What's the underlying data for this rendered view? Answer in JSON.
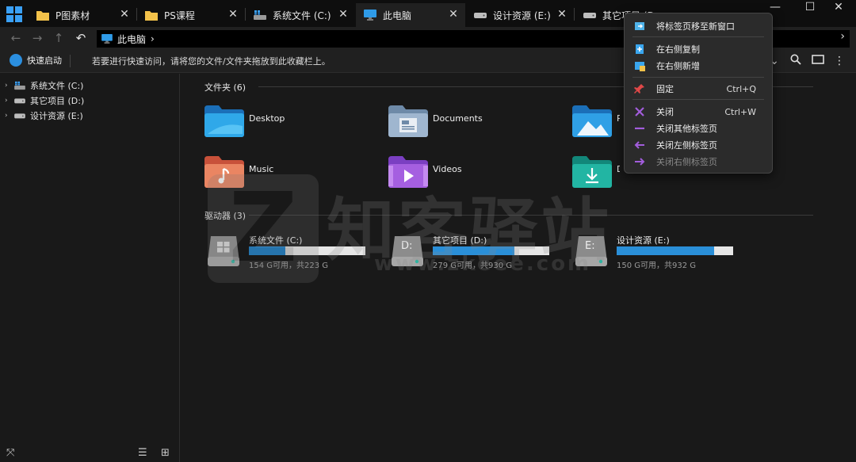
{
  "tabs": [
    {
      "label": "P图素材",
      "icon": "folder-icon"
    },
    {
      "label": "PS课程",
      "icon": "folder-icon"
    },
    {
      "label": "系统文件 (C:)",
      "icon": "windows-drive-icon"
    },
    {
      "label": "此电脑",
      "icon": "monitor-icon",
      "active": true
    },
    {
      "label": "设计资源 (E:)",
      "icon": "drive-icon"
    },
    {
      "label": "其它项目 (D:)",
      "icon": "drive-icon"
    }
  ],
  "window_controls": {
    "minimize": "—",
    "maximize": "☐",
    "close": "✕"
  },
  "nav": {
    "back": "←",
    "forward": "→",
    "up": "↑",
    "refresh": "↶"
  },
  "address": {
    "path": "此电脑",
    "chevron": "›",
    "end_chevron": "›"
  },
  "quick_access": {
    "label": "快速启动",
    "hint": "若要进行快速访问，请将您的文件/文件夹拖放到此收藏栏上。"
  },
  "sidebar": {
    "items": [
      {
        "label": "系统文件 (C:)",
        "icon": "windows-drive-icon"
      },
      {
        "label": "其它项目 (D:)",
        "icon": "drive-icon"
      },
      {
        "label": "设计资源 (E:)",
        "icon": "drive-icon"
      }
    ]
  },
  "folders_section": {
    "title": "文件夹 (6)",
    "items": [
      {
        "name": "Desktop",
        "icon": "desktop-folder-icon"
      },
      {
        "name": "Documents",
        "icon": "documents-folder-icon"
      },
      {
        "name": "Pi",
        "icon": "pictures-folder-icon"
      },
      {
        "name": "Music",
        "icon": "music-folder-icon"
      },
      {
        "name": "Videos",
        "icon": "videos-folder-icon"
      },
      {
        "name": "Do",
        "icon": "downloads-folder-icon"
      }
    ]
  },
  "drives_section": {
    "title": "驱动器 (3)",
    "items": [
      {
        "name": "系统文件 (C:)",
        "letter": "",
        "free": "154 G可用，共223 G",
        "used_fraction": 0.31
      },
      {
        "name": "其它项目 (D:)",
        "letter": "D:",
        "free": "279 G可用，共930 G",
        "used_fraction": 0.7
      },
      {
        "name": "设计资源 (E:)",
        "letter": "E:",
        "free": "150 G可用，共932 G",
        "used_fraction": 0.84
      }
    ]
  },
  "context_menu": {
    "items": [
      {
        "label": "将标签页移至新窗口",
        "shortcut": "",
        "icon": "new-window-icon"
      },
      {
        "label": "在右侧复制",
        "shortcut": "",
        "icon": "duplicate-icon"
      },
      {
        "label": "在右侧新增",
        "shortcut": "",
        "icon": "new-tab-icon"
      },
      {
        "label": "固定",
        "shortcut": "Ctrl+Q",
        "icon": "pin-icon"
      },
      {
        "label": "关闭",
        "shortcut": "Ctrl+W",
        "icon": "close-icon"
      },
      {
        "label": "关闭其他标签页",
        "shortcut": "",
        "icon": "minus-icon"
      },
      {
        "label": "关闭左侧标签页",
        "shortcut": "",
        "icon": "arrow-left-icon"
      },
      {
        "label": "关闭右侧标签页",
        "shortcut": "",
        "icon": "arrow-right-icon",
        "disabled": true
      }
    ]
  },
  "watermark": {
    "logo_letter": "Z",
    "text": "知客驿站",
    "url": "www.zkeee.com"
  },
  "colors": {
    "accent": "#2a8fd8",
    "menu_bg": "#2b2b2b",
    "background": "#191919",
    "purple": "#a25ddc"
  }
}
